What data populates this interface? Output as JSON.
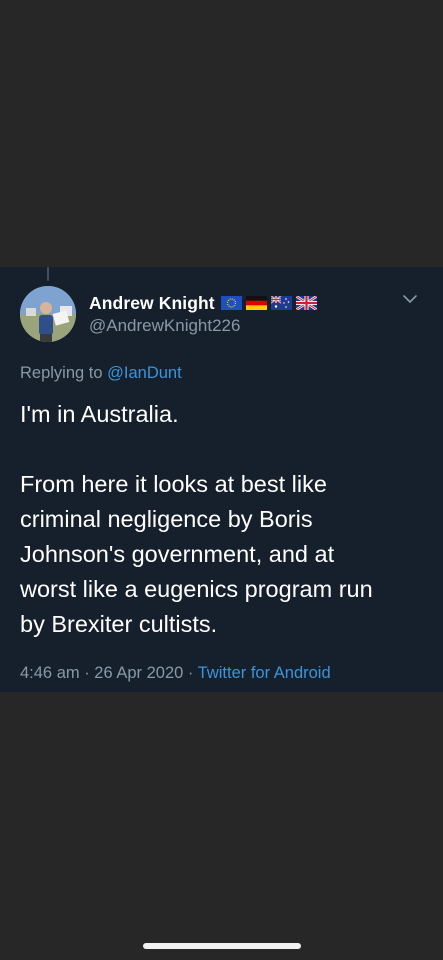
{
  "tweet": {
    "display_name": "Andrew Knight",
    "handle": "@AndrewKnight226",
    "flags": [
      "eu-flag-icon",
      "germany-flag-icon",
      "australia-flag-icon",
      "uk-flag-icon"
    ],
    "reply_prefix": "Replying to ",
    "reply_mention": "@IanDunt",
    "body": {
      "line1": "I'm in Australia.",
      "paragraph2": [
        "From here it looks at best like",
        "criminal negligence by Boris",
        "Johnson's government, and at",
        "worst like a eugenics program run",
        "by Brexiter cultists."
      ]
    },
    "time": "4:46 am",
    "separator1": " · ",
    "date": "26 Apr 2020",
    "separator2": " · ",
    "source": "Twitter for Android"
  },
  "colors": {
    "background": "#272727",
    "tweet_background": "#16202c",
    "secondary_text": "#8899a6",
    "link": "#3b94d9",
    "primary_text": "#ffffff"
  }
}
